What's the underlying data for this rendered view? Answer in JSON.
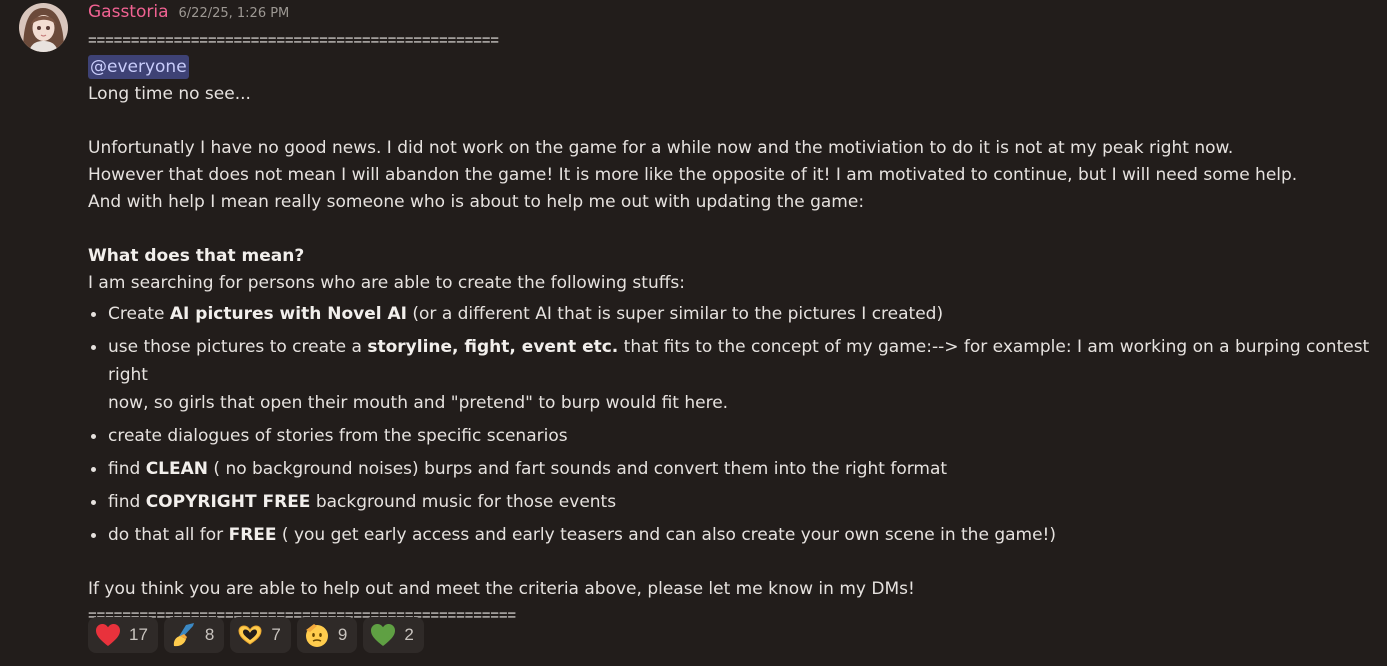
{
  "message": {
    "author": "Gasstoria",
    "timestamp": "6/22/25, 1:26 PM",
    "separator_top": "================================================",
    "mention": "@everyone",
    "greeting": "Long time no see...",
    "para1": [
      "Unfortunatly I have no good news. I did not work on the game for a while now and the motiviation to do it is not at my peak right now.",
      "However that does not mean I will abandon the game! It is more like the opposite of it! I am motivated to continue, but I will need some help.",
      "And with help I mean really someone who is about to help me out with updating the game:"
    ],
    "heading": "What does that mean?",
    "intro": "I am searching for persons who are able to create the following stuffs:",
    "bullets": {
      "b1": {
        "pre": "Create ",
        "bold": "AI pictures with Novel AI",
        "post": " (or a different AI that is super similar to the pictures I created)"
      },
      "b2": {
        "pre": "use those pictures to create a ",
        "bold": "storyline, fight, event etc.",
        "post": " that fits to the concept of my game:--> for example: I am working on a burping contest right",
        "cont": "now, so girls that open their mouth and \"pretend\" to burp would fit here."
      },
      "b3": {
        "text": "create dialogues of stories from the specific scenarios"
      },
      "b4": {
        "pre": "find ",
        "bold": "CLEAN",
        "post": " ( no background noises) burps and fart sounds and convert them into the right format"
      },
      "b5": {
        "pre": "find ",
        "bold": "COPYRIGHT FREE",
        "post": " background music for those events"
      },
      "b6": {
        "pre": "do that all for ",
        "bold": "FREE",
        "post": " ( you get early access and early teasers and can also create your own scene in the game!)"
      }
    },
    "closing": "If you think you are able to help out and meet the criteria above, please let me know in my DMs!",
    "separator_bottom": "=================================================="
  },
  "reactions": [
    {
      "emoji": "heart",
      "count": "17"
    },
    {
      "emoji": "writing-hand",
      "count": "8"
    },
    {
      "emoji": "heart-hands",
      "count": "7"
    },
    {
      "emoji": "saluting-face",
      "count": "9"
    },
    {
      "emoji": "green-heart",
      "count": "2"
    }
  ],
  "colors": {
    "background": "#221d1b",
    "username": "#f06292",
    "mention_bg": "#3e4275",
    "mention_text": "#c9cdfb",
    "reaction_bg": "#2f2a28"
  }
}
